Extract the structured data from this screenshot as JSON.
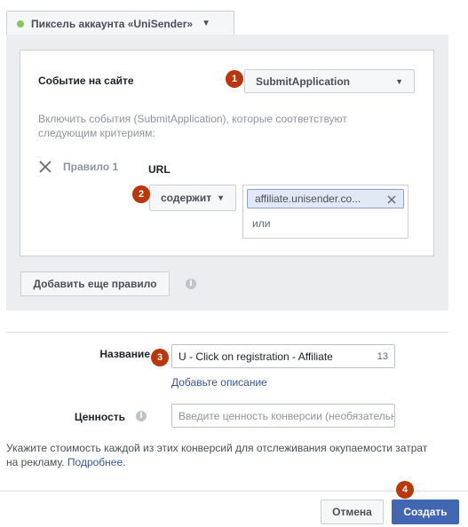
{
  "pixel": {
    "label": "Пиксель аккаунта «UniSender»"
  },
  "event": {
    "label": "Событие на сайте",
    "selected": "SubmitApplication",
    "description": "Включить события (SubmitApplication), которые соответствуют следующим критериям:"
  },
  "rule": {
    "label": "Правило 1",
    "field_label": "URL",
    "operator": "содержит",
    "token": "affiliate.unisender.co...",
    "or_placeholder": "или"
  },
  "add_rule_button": "Добавить еще правило",
  "name": {
    "label": "Название",
    "value": "U - Click on registration - Affiliate",
    "char_count": "13",
    "add_description": "Добавьте описание"
  },
  "value_field": {
    "label": "Ценность",
    "placeholder": "Введите ценность конверсии (необязательно)"
  },
  "help": {
    "text": "Укажите стоимость каждой из этих конверсий для отслеживания окупаемости затрат на рекламу.",
    "link": "Подробнее."
  },
  "footer": {
    "cancel": "Отмена",
    "create": "Создать"
  },
  "badges": [
    "1",
    "2",
    "3",
    "4"
  ],
  "colors": {
    "badge": "#b8380c",
    "primary": "#4267b2",
    "link": "#365899",
    "status_dot": "#8ac25b"
  }
}
